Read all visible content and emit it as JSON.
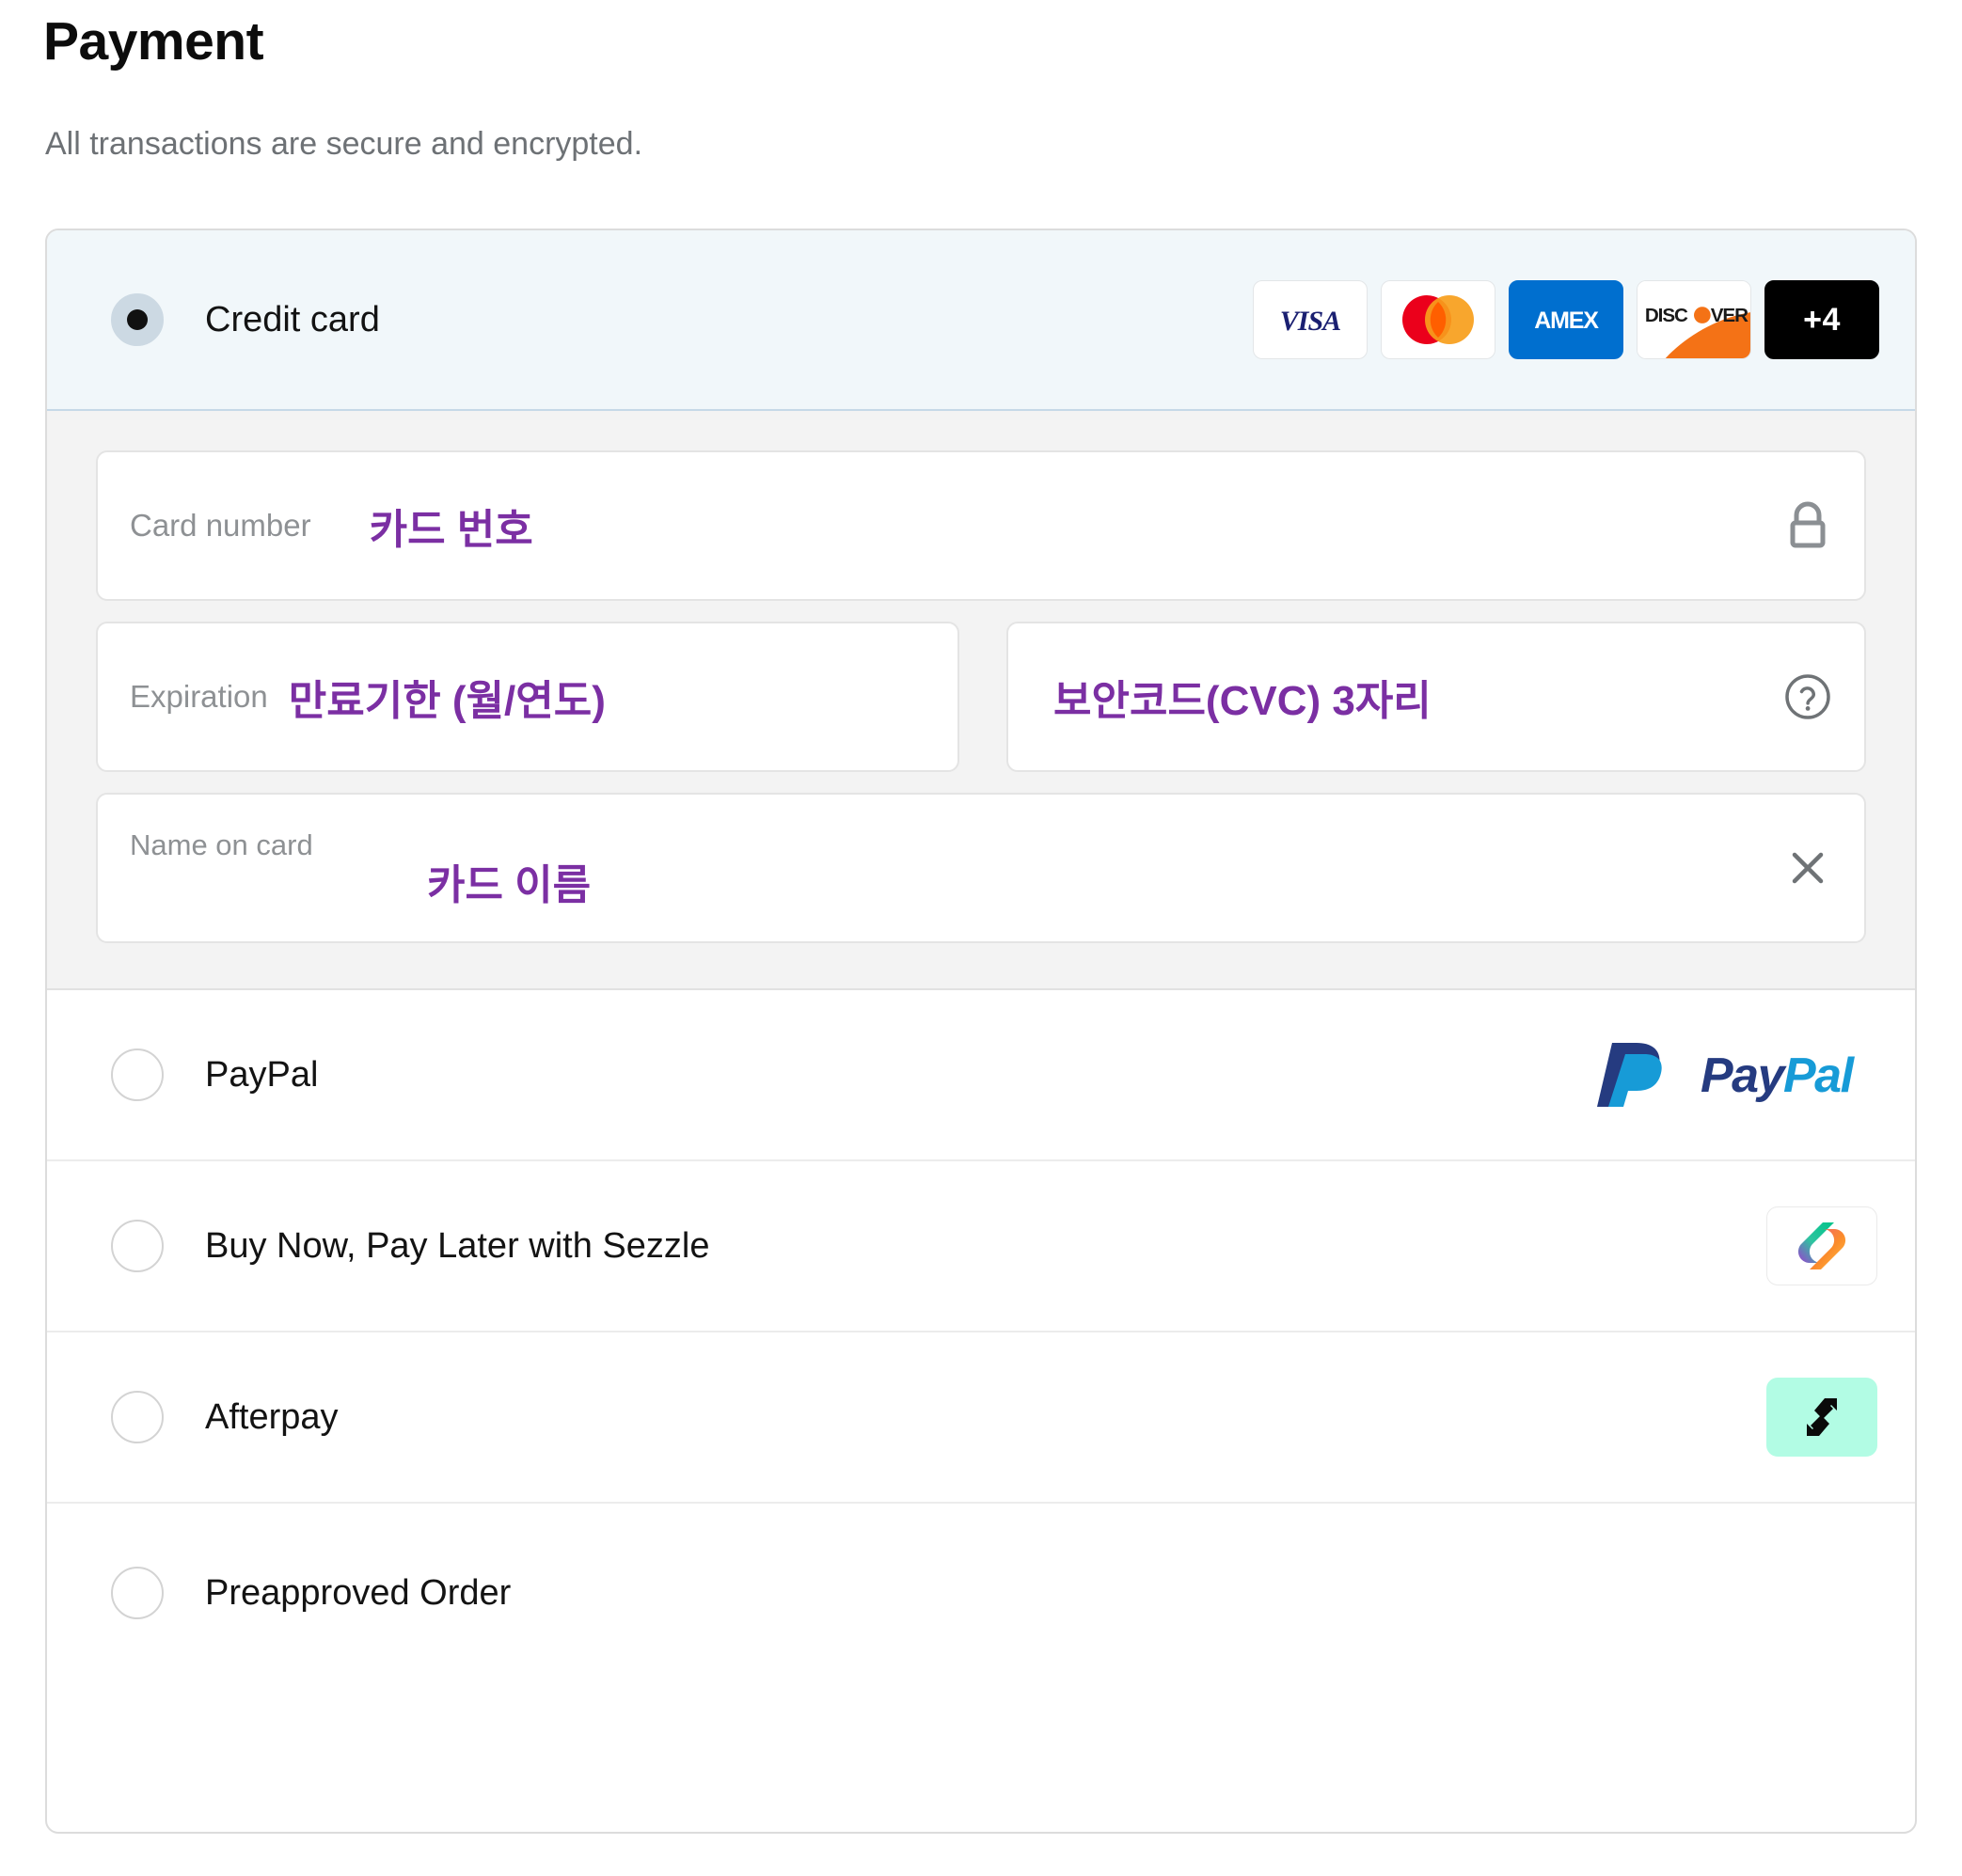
{
  "header": {
    "title": "Payment",
    "subtitle": "All transactions are secure and encrypted."
  },
  "credit_card": {
    "label": "Credit card",
    "selected": true,
    "brands": [
      {
        "name": "visa",
        "label": "VISA"
      },
      {
        "name": "mastercard",
        "label": "Mastercard"
      },
      {
        "name": "amex",
        "label": "AMEX"
      },
      {
        "name": "discover",
        "label": "DISCOVER"
      },
      {
        "name": "more",
        "label": "+4"
      }
    ],
    "fields": {
      "card_number": {
        "placeholder": "Card number",
        "annotation": "카드 번호",
        "icon": "lock-icon"
      },
      "expiration": {
        "placeholder": "Expiration",
        "annotation": "만료기한 (월/연도)"
      },
      "security_code": {
        "placeholder": "",
        "annotation": "보안코드(CVC) 3자리",
        "icon": "question-mark-icon"
      },
      "name_on_card": {
        "placeholder": "Name on card",
        "annotation": "카드 이름",
        "icon": "clear-x-icon"
      }
    }
  },
  "alternatives": [
    {
      "label": "PayPal",
      "logo": "paypal-logo",
      "selected": false
    },
    {
      "label": "Buy Now, Pay Later with Sezzle",
      "logo": "sezzle-logo",
      "selected": false
    },
    {
      "label": "Afterpay",
      "logo": "afterpay-logo",
      "selected": false
    },
    {
      "label": "Preapproved Order",
      "logo": "",
      "selected": false
    }
  ],
  "colors": {
    "annotation_purple": "#7b2fa3",
    "selected_row_bg": "#f1f7fa",
    "selected_row_border": "#c6d9e7",
    "form_bg": "#f3f3f3",
    "afterpay_mint": "#b2fce4",
    "amex_blue": "#006fcf"
  }
}
